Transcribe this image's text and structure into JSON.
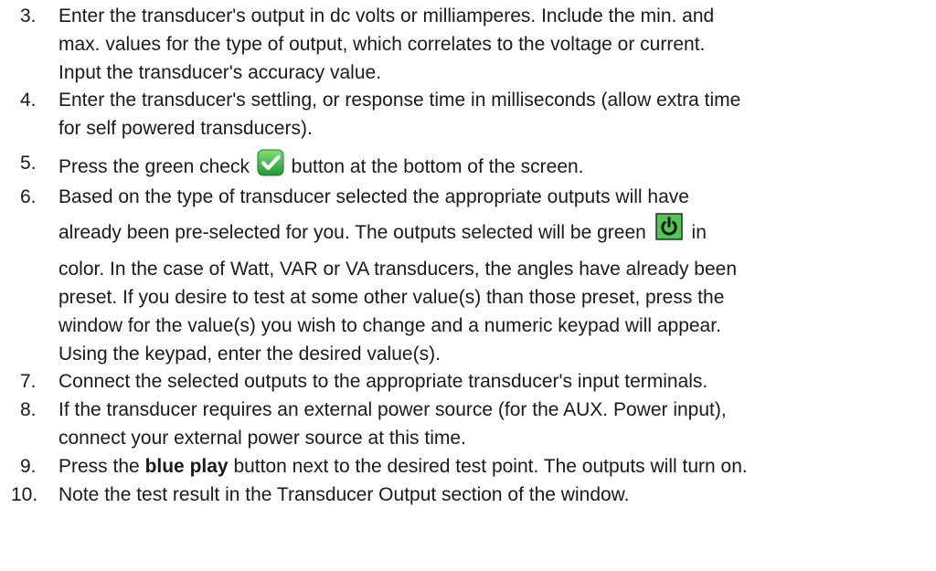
{
  "steps": [
    {
      "number": "3.",
      "lines": [
        "Enter the transducer's output in dc volts or milliamperes. Include the min. and",
        "max. values for the type of output, which correlates to the voltage or current.",
        "Input the transducer's accuracy value."
      ]
    },
    {
      "number": "4.",
      "lines": [
        "Enter the transducer's settling, or response time in milliseconds (allow extra time",
        "for self powered transducers)."
      ]
    },
    {
      "number": "5.",
      "before_icon": "Press the green check",
      "after_icon": "button at the bottom of the screen.",
      "icon": "green-check-icon",
      "icon_color": "#3ab54a"
    },
    {
      "number": "6.",
      "line1": "Based on the type of transducer selected the appropriate outputs will have",
      "line2_before_icon": "already been pre-selected for you. The outputs selected will be green",
      "line2_after_icon": "in",
      "icon": "power-icon",
      "icon_color": "#3ab54a",
      "lines_rest": [
        "color. In the case of Watt, VAR or VA transducers, the angles have already been",
        "preset. If you desire to test at some other value(s) than those preset, press the",
        "window for the value(s) you wish to change and a numeric keypad will appear.",
        "Using the keypad, enter the desired value(s)."
      ]
    },
    {
      "number": "7.",
      "lines": [
        "Connect the selected outputs to the appropriate transducer's input terminals."
      ]
    },
    {
      "number": "8.",
      "lines": [
        "If the transducer requires an external power source (for the AUX. Power input),",
        "connect your external power source at this time."
      ]
    },
    {
      "number": "9.",
      "before_bold": "Press the",
      "bold": "blue play",
      "after_bold": "button next to the desired test point. The outputs will turn on."
    },
    {
      "number": "10.",
      "lines": [
        "Note the test result in the Transducer Output section of the window."
      ]
    }
  ]
}
